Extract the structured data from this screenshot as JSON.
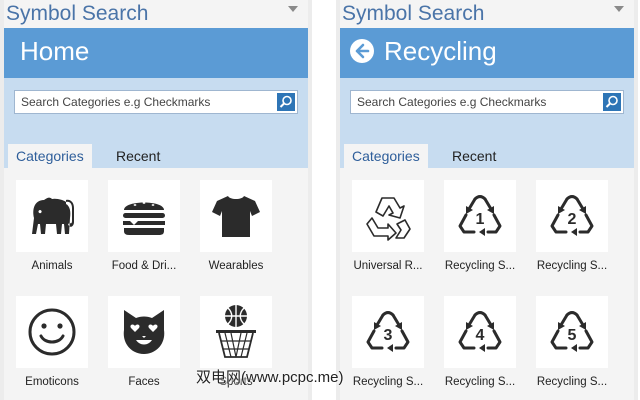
{
  "left": {
    "title": "Symbol Search",
    "header": "Home",
    "search_placeholder": "Search Categories e.g Checkmarks",
    "tabs": [
      {
        "label": "Categories",
        "active": true
      },
      {
        "label": "Recent",
        "active": false
      }
    ],
    "tiles": [
      {
        "label": "Animals",
        "icon": "elephant-icon"
      },
      {
        "label": "Food & Dri...",
        "icon": "burger-icon"
      },
      {
        "label": "Wearables",
        "icon": "tshirt-icon"
      },
      {
        "label": "Emoticons",
        "icon": "smiley-icon"
      },
      {
        "label": "Faces",
        "icon": "heart-eyes-cat-icon"
      },
      {
        "label": "Sports",
        "icon": "basketball-hoop-icon"
      }
    ]
  },
  "right": {
    "title": "Symbol Search",
    "header": "Recycling",
    "search_placeholder": "Search Categories e.g Checkmarks",
    "tabs": [
      {
        "label": "Categories",
        "active": true
      },
      {
        "label": "Recent",
        "active": false
      }
    ],
    "tiles": [
      {
        "label": "Universal R...",
        "icon": "universal-recycling-icon",
        "number": ""
      },
      {
        "label": "Recycling S...",
        "icon": "recycling-1-icon",
        "number": "1"
      },
      {
        "label": "Recycling S...",
        "icon": "recycling-2-icon",
        "number": "2"
      },
      {
        "label": "Recycling S...",
        "icon": "recycling-3-icon",
        "number": "3"
      },
      {
        "label": "Recycling S...",
        "icon": "recycling-4-icon",
        "number": "4"
      },
      {
        "label": "Recycling S...",
        "icon": "recycling-5-icon",
        "number": "5"
      }
    ]
  },
  "watermark": "双电网(www.pcpc.me)",
  "colors": {
    "header": "#5b9bd5",
    "band": "#c7dcf0",
    "title": "#4a74a8",
    "search_button": "#2e75b6"
  }
}
